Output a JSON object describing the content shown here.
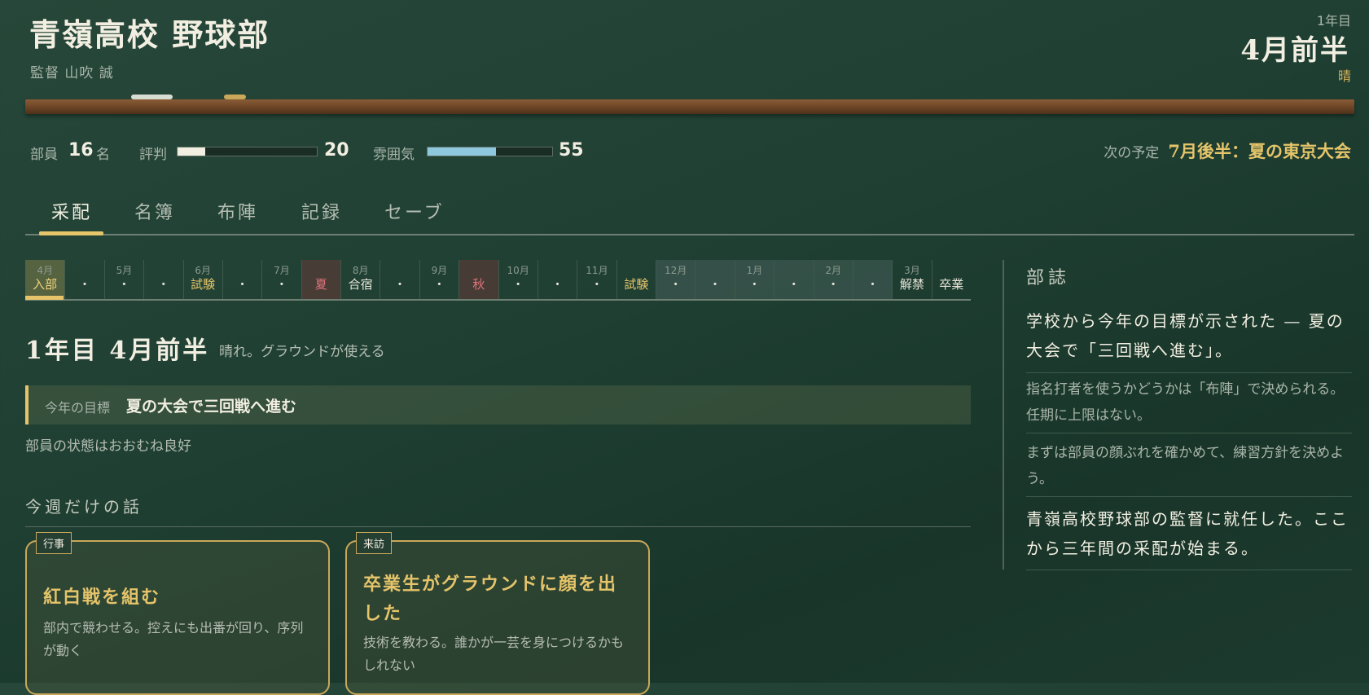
{
  "header": {
    "school": "青嶺高校 野球部",
    "coach": "監督 山吹 誠",
    "year": "1年目",
    "half": "4月前半",
    "weather": "晴"
  },
  "stats": {
    "members_label": "部員",
    "members_value": "16",
    "members_unit": "名",
    "reputation_label": "評判",
    "reputation_value": "20",
    "reputation_fraction": 0.2,
    "morale_label": "雰囲気",
    "morale_value": "55",
    "morale_fraction": 0.55,
    "next_label": "次の予定",
    "next_value": "7月後半：夏の東京大会",
    "reputation_color": "#f2efe2",
    "morale_color": "#8fc7de"
  },
  "tabs": [
    {
      "label": "采配"
    },
    {
      "label": "名簿"
    },
    {
      "label": "布陣"
    },
    {
      "label": "記録"
    },
    {
      "label": "セーブ"
    }
  ],
  "calendar": [
    {
      "m": "4月",
      "d": "入部",
      "style": "current"
    },
    {
      "m": "",
      "d": "・"
    },
    {
      "m": "5月",
      "d": "・"
    },
    {
      "m": "",
      "d": "・"
    },
    {
      "m": "6月",
      "d": "試験",
      "style": "gold"
    },
    {
      "m": "",
      "d": "・"
    },
    {
      "m": "7月",
      "d": "・"
    },
    {
      "m": "",
      "d": "夏",
      "style": "red"
    },
    {
      "m": "8月",
      "d": "合宿"
    },
    {
      "m": "",
      "d": "・"
    },
    {
      "m": "9月",
      "d": "・"
    },
    {
      "m": "",
      "d": "秋",
      "style": "red"
    },
    {
      "m": "10月",
      "d": "・"
    },
    {
      "m": "",
      "d": "・"
    },
    {
      "m": "11月",
      "d": "・"
    },
    {
      "m": "",
      "d": "試験",
      "style": "gold"
    },
    {
      "m": "12月",
      "d": "・",
      "style": "winter"
    },
    {
      "m": "",
      "d": "・",
      "style": "winter"
    },
    {
      "m": "1月",
      "d": "・",
      "style": "winter"
    },
    {
      "m": "",
      "d": "・",
      "style": "winter"
    },
    {
      "m": "2月",
      "d": "・",
      "style": "winter"
    },
    {
      "m": "",
      "d": "・",
      "style": "winter"
    },
    {
      "m": "3月",
      "d": "解禁"
    },
    {
      "m": "",
      "d": "卒業"
    }
  ],
  "main": {
    "date_title": "1年目 4月前半",
    "date_note": "晴れ。グラウンドが使える",
    "goal_label": "今年の目標",
    "goal_text": "夏の大会で三回戦へ進む",
    "condition": "部員の状態はおおむね良好",
    "week_title": "今週だけの話"
  },
  "cards": [
    {
      "tag": "行事",
      "title": "紅白戦を組む",
      "desc": "部内で競わせる。控えにも出番が回り、序列が動く"
    },
    {
      "tag": "来訪",
      "title": "卒業生がグラウンドに顔を出した",
      "desc": "技術を教わる。誰かが一芸を身につけるかもしれない"
    }
  ],
  "journal": {
    "title": "部誌",
    "entries": [
      {
        "text": "学校から今年の目標が示された — 夏の大会で「三回戦へ進む」。",
        "size": "big"
      },
      {
        "text": "指名打者を使うかどうかは「布陣」で決められる。任期に上限はない。",
        "size": "small"
      },
      {
        "text": "まずは部員の顔ぶれを確かめて、練習方針を決めよう。",
        "size": "small"
      },
      {
        "text": "青嶺高校野球部の監督に就任した。ここから三年間の采配が始まる。",
        "size": "big"
      }
    ]
  }
}
